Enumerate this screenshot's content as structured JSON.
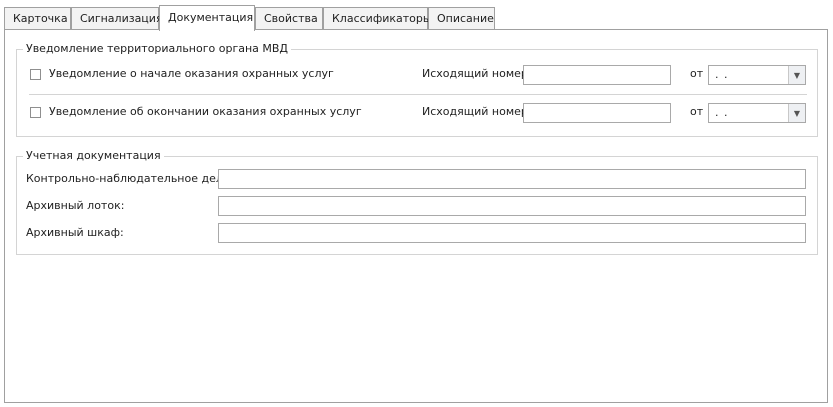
{
  "tabs": [
    {
      "label": "Карточка",
      "active": false
    },
    {
      "label": "Сигнализация",
      "active": false
    },
    {
      "label": "Документация",
      "active": true
    },
    {
      "label": "Свойства",
      "active": false
    },
    {
      "label": "Классификаторы",
      "active": false
    },
    {
      "label": "Описание",
      "active": false
    }
  ],
  "notification": {
    "title": "Уведомление территориального органа МВД",
    "rows": [
      {
        "label": "Уведомление о начале оказания охранных услуг",
        "checked": false,
        "number_label": "Исходящий номер:",
        "number_value": "",
        "date_label": "от",
        "date_value": ". ."
      },
      {
        "label": "Уведомление об окончании оказания охранных услуг",
        "checked": false,
        "number_label": "Исходящий номер:",
        "number_value": "",
        "date_label": "от",
        "date_value": ". ."
      }
    ]
  },
  "accounting": {
    "title": "Учетная документация",
    "fields": [
      {
        "label": "Контрольно-наблюдательное дело:",
        "value": ""
      },
      {
        "label": "Архивный лоток:",
        "value": ""
      },
      {
        "label": "Архивный шкаф:",
        "value": ""
      }
    ]
  },
  "icons": {
    "dropdown": "chevron-down-icon"
  }
}
